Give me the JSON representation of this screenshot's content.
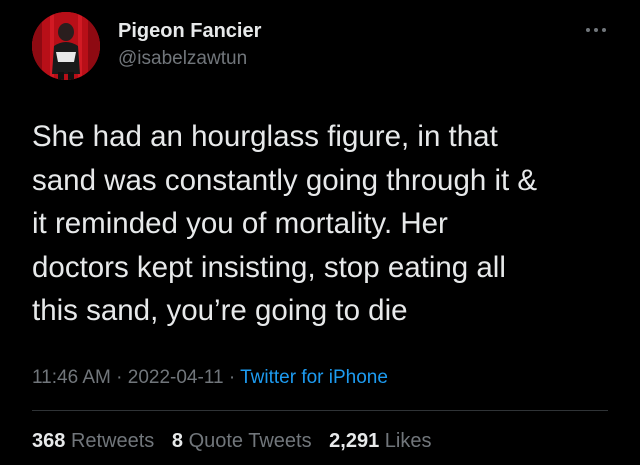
{
  "author": {
    "display_name": "Pigeon Fancier",
    "handle": "@isabelzawtun"
  },
  "tweet": {
    "text": "She had an hourglass figure, in that\nsand was constantly going through it &\nit reminded you of mortality. Her\ndoctors kept insisting, stop eating all\nthis sand, you’re going to die",
    "time": "11:46 AM",
    "date": "2022-04-11",
    "source": "Twitter for iPhone"
  },
  "stats": {
    "retweets_count": "368",
    "retweets_label": "Retweets",
    "quotes_count": "8",
    "quotes_label": "Quote Tweets",
    "likes_count": "2,291",
    "likes_label": "Likes"
  },
  "icons": {
    "more": "more-horizontal-icon"
  },
  "colors": {
    "background": "#000000",
    "text": "#e7e9ea",
    "secondary": "#71767b",
    "link": "#1d9bf0",
    "avatar_bg": "#c0101a"
  }
}
